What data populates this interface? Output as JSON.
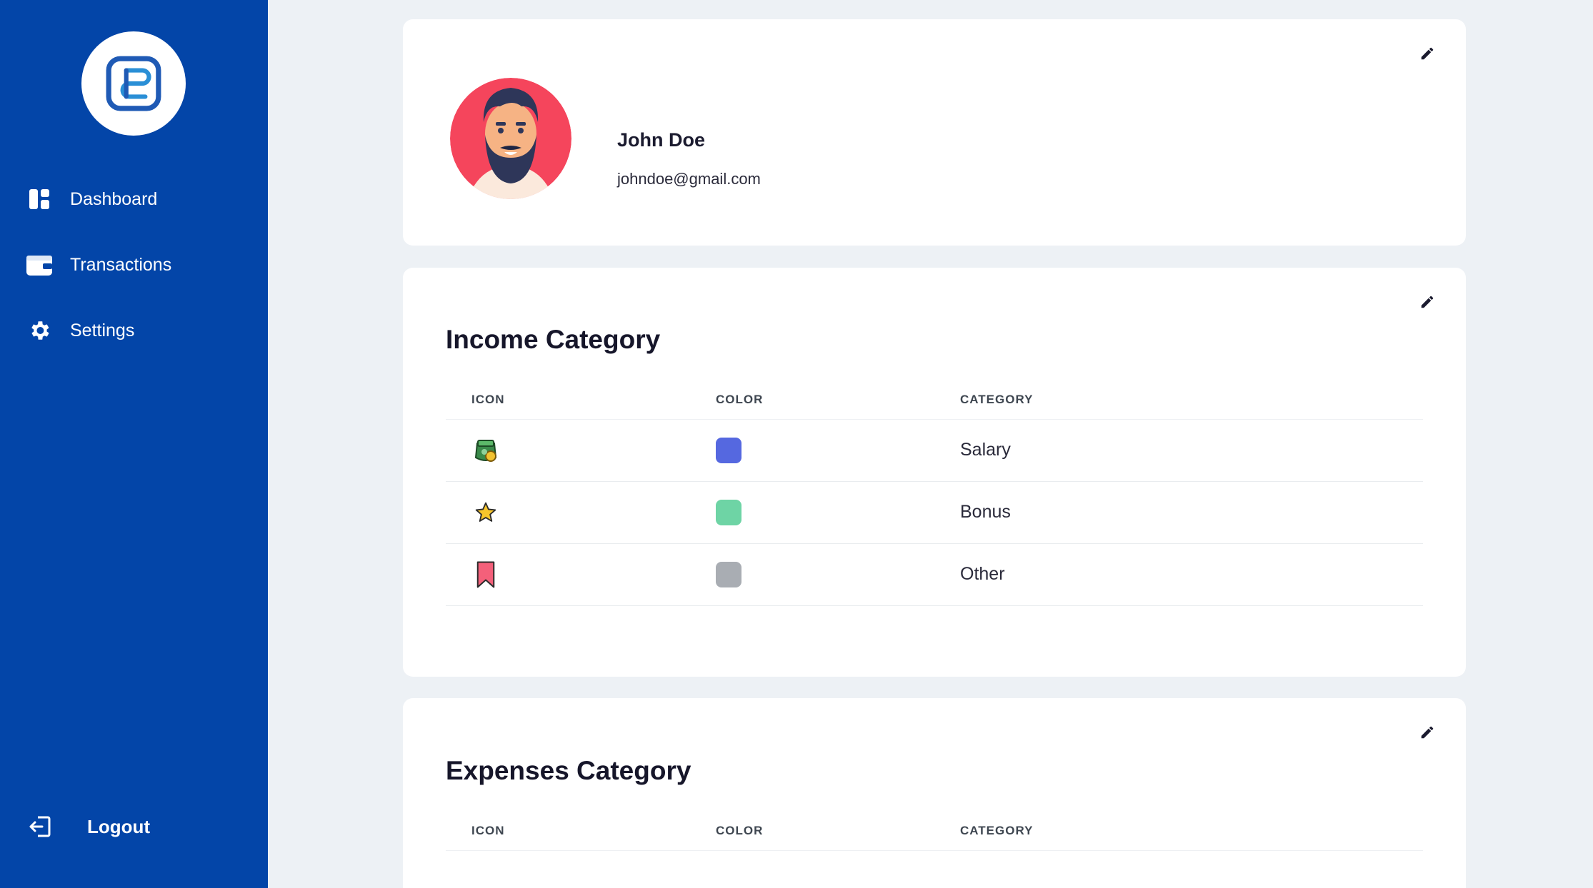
{
  "sidebar": {
    "items": [
      {
        "label": "Dashboard",
        "icon": "dashboard-icon"
      },
      {
        "label": "Transactions",
        "icon": "wallet-icon"
      },
      {
        "label": "Settings",
        "icon": "gear-icon"
      }
    ],
    "logout_label": "Logout"
  },
  "profile": {
    "name": "John Doe",
    "email": "johndoe@gmail.com"
  },
  "income": {
    "title": "Income Category",
    "headers": {
      "icon": "ICON",
      "color": "COLOR",
      "category": "CATEGORY"
    },
    "rows": [
      {
        "icon": "money-bag-icon",
        "color": "#5568e0",
        "category": "Salary"
      },
      {
        "icon": "star-icon",
        "color": "#6ed4a5",
        "category": "Bonus"
      },
      {
        "icon": "bookmark-icon",
        "color": "#a9adb3",
        "category": "Other"
      }
    ]
  },
  "expenses": {
    "title": "Expenses Category",
    "headers": {
      "icon": "ICON",
      "color": "COLOR",
      "category": "CATEGORY"
    }
  },
  "colors": {
    "sidebar": "#0345a8",
    "background": "#edf1f5"
  }
}
